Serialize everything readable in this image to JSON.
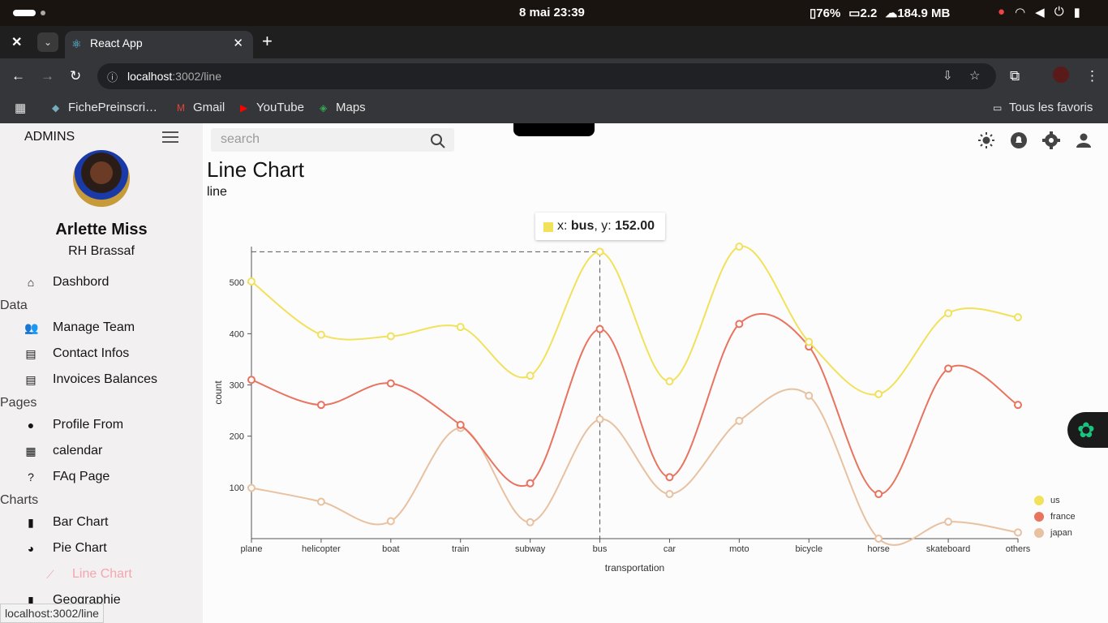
{
  "system": {
    "clock": "8 mai  23:39",
    "battery": "76%",
    "cpu": "2.2",
    "mem": "184.9 MB"
  },
  "browser": {
    "tab_title": "React App",
    "url_host": "localhost",
    "url_path": ":3002/line",
    "bookmarks": [
      "FichePreinscri…",
      "Gmail",
      "YouTube",
      "Maps"
    ],
    "all_bookmarks": "Tous les favoris",
    "status_url": "localhost:3002/line"
  },
  "sidebar": {
    "brand": "ADMINS",
    "user_name": "Arlette Miss",
    "user_role": "RH Brassaf",
    "sections": {
      "data": "Data",
      "pages": "Pages",
      "charts": "Charts"
    },
    "items": {
      "dashboard": "Dashbord",
      "team": "Manage Team",
      "contacts": "Contact Infos",
      "invoices": "Invoices Balances",
      "profile": "Profile From",
      "calendar": "calendar",
      "faq": "FAq Page",
      "bar": "Bar Chart",
      "pie": "Pie Chart",
      "line": "Line Chart",
      "geo": "Geographie"
    }
  },
  "header": {
    "search_placeholder": "search",
    "title": "Line Chart",
    "subtitle": "line"
  },
  "tooltip": {
    "prefix": "x: ",
    "x": "bus",
    "mid": ", y: ",
    "y": "152.00"
  },
  "colors": {
    "us": "#f1e15b",
    "france": "#e8735f",
    "japan": "#e8c1a0",
    "accent": "#f4a6b0"
  },
  "chart_data": {
    "type": "line",
    "xlabel": "transportation",
    "ylabel": "count",
    "categories": [
      "plane",
      "helicopter",
      "boat",
      "train",
      "subway",
      "bus",
      "car",
      "moto",
      "bicycle",
      "horse",
      "skateboard",
      "others"
    ],
    "ylim": [
      0,
      570
    ],
    "yticks": [
      100,
      200,
      300,
      400,
      500
    ],
    "series": [
      {
        "name": "us",
        "color": "#f1e15b",
        "values": [
          502,
          398,
          395,
          413,
          318,
          560,
          307,
          570,
          384,
          282,
          440,
          432
        ]
      },
      {
        "name": "france",
        "color": "#e8735f",
        "values": [
          310,
          261,
          303,
          222,
          108,
          409,
          120,
          419,
          375,
          87,
          332,
          261
        ]
      },
      {
        "name": "japan",
        "color": "#e8c1a0",
        "values": [
          99,
          72,
          34,
          216,
          32,
          233,
          87,
          230,
          279,
          0,
          33,
          12
        ]
      }
    ],
    "legend": "bottom-right"
  }
}
